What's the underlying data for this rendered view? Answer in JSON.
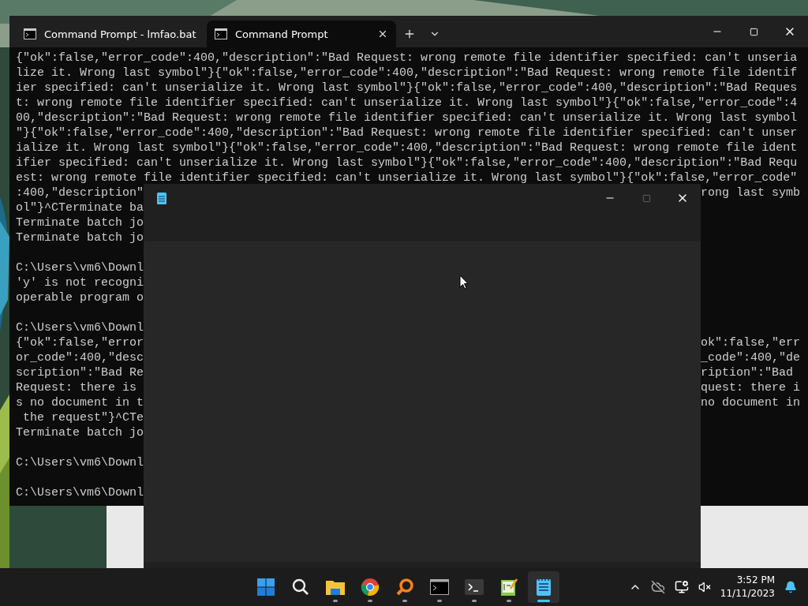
{
  "terminal": {
    "tabs": [
      {
        "title": "Command Prompt - lmfao.bat",
        "selected": false
      },
      {
        "title": "Command Prompt",
        "selected": true
      }
    ],
    "lines": [
      {
        "kind": "full",
        "text": "{\"ok\":false,\"error_code\":400,\"description\":\"Bad Request: wrong remote file identifier specified: can't unseria"
      },
      {
        "kind": "full",
        "text": "lize it. Wrong last symbol\"}{\"ok\":false,\"error_code\":400,\"description\":\"Bad Request: wrong remote file identif"
      },
      {
        "kind": "full",
        "text": "ier specified: can't unserialize it. Wrong last symbol\"}{\"ok\":false,\"error_code\":400,\"description\":\"Bad Reques"
      },
      {
        "kind": "full",
        "text": "t: wrong remote file identifier specified: can't unserialize it. Wrong last symbol\"}{\"ok\":false,\"error_code\":4"
      },
      {
        "kind": "full",
        "text": "00,\"description\":\"Bad Request: wrong remote file identifier specified: can't unserialize it. Wrong last symbol"
      },
      {
        "kind": "full",
        "text": "\"}{\"ok\":false,\"error_code\":400,\"description\":\"Bad Request: wrong remote file identifier specified: can't unser"
      },
      {
        "kind": "full",
        "text": "ialize it. Wrong last symbol\"}{\"ok\":false,\"error_code\":400,\"description\":\"Bad Request: wrong remote file ident"
      },
      {
        "kind": "full",
        "text": "ifier specified: can't unserialize it. Wrong last symbol\"}{\"ok\":false,\"error_code\":400,\"description\":\"Bad Requ"
      },
      {
        "kind": "full",
        "text": "est: wrong remote file identifier specified: can't unserialize it. Wrong last symbol\"}{\"ok\":false,\"error_code\""
      },
      {
        "kind": "split",
        "left": ":400,\"description\"",
        "right": "rong last symb"
      },
      {
        "kind": "split",
        "left": "ol\"}^CTerminate ba"
      },
      {
        "kind": "split",
        "left": "Terminate batch jo"
      },
      {
        "kind": "split",
        "left": "Terminate batch jo"
      },
      {
        "kind": "blank"
      },
      {
        "kind": "split",
        "left": "C:\\Users\\vm6\\Downl"
      },
      {
        "kind": "split",
        "left": "'y' is not recogni"
      },
      {
        "kind": "split",
        "left": "operable program o"
      },
      {
        "kind": "blank"
      },
      {
        "kind": "split",
        "left": "C:\\Users\\vm6\\Downl"
      },
      {
        "kind": "split",
        "left": "{\"ok\":false,\"error",
        "right": "ok\":false,\"err"
      },
      {
        "kind": "split",
        "left": "or_code\":400,\"desc",
        "right": "_code\":400,\"de"
      },
      {
        "kind": "split",
        "left": "scription\":\"Bad Re",
        "right": "ription\":\"Bad"
      },
      {
        "kind": "split",
        "left": "Request: there is",
        "right": "quest: there i"
      },
      {
        "kind": "split",
        "left": "s no document in t",
        "right": "no document in"
      },
      {
        "kind": "split",
        "left": " the request\"}^CTe"
      },
      {
        "kind": "split",
        "left": "Terminate batch jo"
      },
      {
        "kind": "blank"
      },
      {
        "kind": "split",
        "left": "C:\\Users\\vm6\\Downl"
      },
      {
        "kind": "blank"
      },
      {
        "kind": "split",
        "left": "C:\\Users\\vm6\\Downl"
      }
    ]
  },
  "taskbar": {
    "apps": [
      {
        "kind": "start",
        "running": false,
        "selected": false
      },
      {
        "kind": "search",
        "running": false,
        "selected": false
      },
      {
        "kind": "folder",
        "running": true,
        "selected": false
      },
      {
        "kind": "browser",
        "running": true,
        "selected": false
      },
      {
        "kind": "magnifier",
        "running": true,
        "selected": false
      },
      {
        "kind": "console",
        "running": true,
        "selected": false
      },
      {
        "kind": "terminal",
        "running": true,
        "selected": false
      },
      {
        "kind": "editor",
        "running": true,
        "selected": false
      },
      {
        "kind": "notepad",
        "running": true,
        "selected": true
      }
    ],
    "time": "3:52 PM",
    "date": "11/11/2023"
  }
}
